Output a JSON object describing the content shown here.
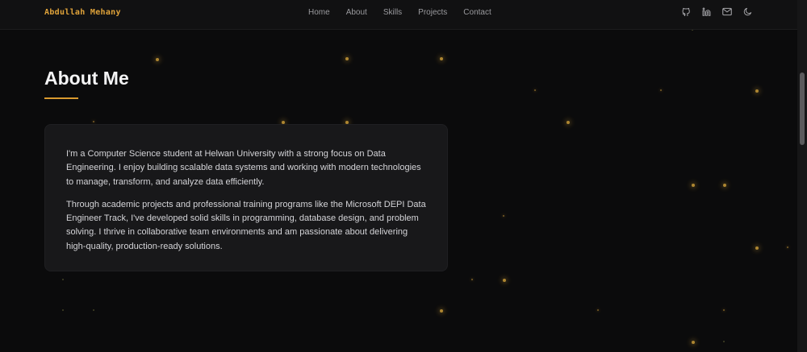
{
  "header": {
    "brand": "Abdullah Mehany",
    "nav": [
      "Home",
      "About",
      "Skills",
      "Projects",
      "Contact"
    ],
    "icons": [
      "github-icon",
      "linkedin-icon",
      "mail-icon",
      "moon-icon"
    ]
  },
  "about": {
    "title": "About Me",
    "paragraphs": [
      "I'm a Computer Science student at Helwan University with a strong focus on Data Engineering. I enjoy building scalable data systems and working with modern technologies to manage, transform, and analyze data efficiently.",
      "Through academic projects and professional training programs like the Microsoft DEPI Data Engineer Track, I've developed solid skills in programming, database design, and problem solving. I thrive in collaborative team environments and am passionate about delivering high-quality, production-ready solutions."
    ]
  },
  "colors": {
    "accent": "#e0a33a",
    "background": "#0b0b0c",
    "card": "#18181a"
  }
}
